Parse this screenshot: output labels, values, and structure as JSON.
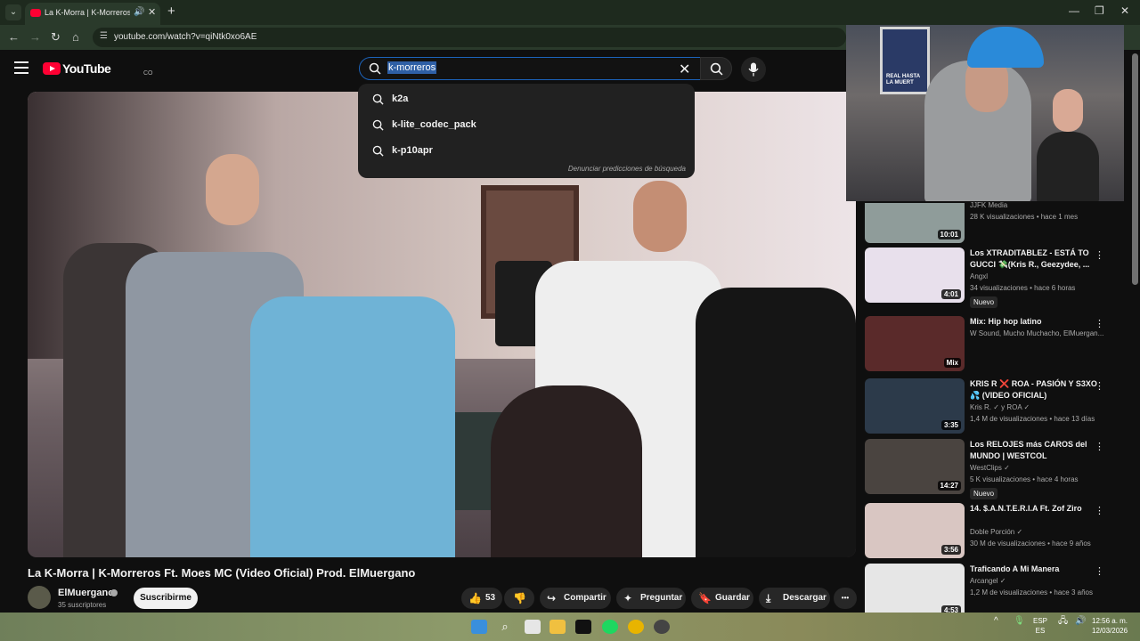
{
  "browser": {
    "tab_title": "La K-Morra | K-Morreros Ft",
    "url": "youtube.com/watch?v=qiNtk0xo6AE",
    "tab_menu_glyph": "⌄",
    "new_tab_glyph": "+",
    "close_glyph": "✕"
  },
  "header": {
    "logo_text": "YouTube",
    "country_code": "CO",
    "search_value": "k-morreros"
  },
  "suggestions": {
    "items": [
      "k2a",
      "k-lite_codec_pack",
      "k-p10apr"
    ],
    "report_label": "Denunciar predicciones de búsqueda"
  },
  "webcam": {
    "poster_text": "REAL HASTA LA MUERT"
  },
  "video": {
    "title": "La K-Morra | K-Morreros Ft. Moes MC (Video Oficial) Prod. ElMuergano",
    "channel": "ElMuergano",
    "subscribers": "35 suscriptores",
    "subscribe_label": "Suscribirme",
    "likes": "53",
    "share_label": "Compartir",
    "ask_label": "Preguntar",
    "save_label": "Guardar",
    "download_label": "Descargar",
    "more_glyph": "•••"
  },
  "sidebar": {
    "items": [
      {
        "title": "",
        "channel": "JJFK Media",
        "meta": "28 K visualizaciones • hace 1 mes",
        "badge": "",
        "duration": "10:01",
        "thumb_color": "#8f9c9a"
      },
      {
        "title": "Los XTRADITABLEZ - ESTÁ TO GUCCI 💸(Kris R., Geezydee, ...",
        "channel": "Angxl",
        "meta": "34 visualizaciones • hace 6 horas",
        "badge": "Nuevo",
        "duration": "4:01",
        "thumb_color": "#e8e0ec"
      },
      {
        "title": "Mix: Hip hop latino",
        "channel": "W Sound, Mucho Muchacho, ElMuergan...",
        "meta": "",
        "badge": "",
        "duration": "Mix",
        "thumb_color": "#5a2a2a"
      },
      {
        "title": "KRIS R ❌ ROA - PASIÓN Y S3XO 💦 (VIDEO OFICIAL)",
        "channel": "Kris R. ✓ y ROA ✓",
        "meta": "1,4 M de visualizaciones • hace 13 días",
        "badge": "",
        "duration": "3:35",
        "thumb_color": "#2c3a4a"
      },
      {
        "title": "Los RELOJES más CAROS del MUNDO | WESTCOL",
        "channel": "WestClips ✓",
        "meta": "5 K visualizaciones • hace 4 horas",
        "badge": "Nuevo",
        "duration": "14:27",
        "thumb_color": "#4a4440"
      },
      {
        "title": "14. $.A.N.T.E.R.I.A Ft.  Zof Ziro",
        "channel": "Doble Porción ✓",
        "meta": "30 M de visualizaciones • hace 9 años",
        "badge": "",
        "duration": "3:56",
        "thumb_color": "#d9c6c2"
      },
      {
        "title": "Traficando A Mi Manera",
        "channel": "Arcangel ✓",
        "meta": "1,2 M de visualizaciones • hace 3 años",
        "badge": "",
        "duration": "4:53",
        "thumb_color": "#e6e6e6"
      }
    ],
    "more_glyph": "⋮"
  },
  "taskbar": {
    "lang_top": "ESP",
    "lang_bottom": "ES",
    "time": "12:56 a. m.",
    "date": "12/03/2026"
  },
  "icons": {
    "back": "back-arrow-icon",
    "forward": "forward-arrow-icon",
    "reload": "reload-icon",
    "home": "home-icon",
    "search": "search-icon",
    "mic": "microphone-icon",
    "like": "thumbs-up-icon",
    "dislike": "thumbs-down-icon"
  },
  "colors": {
    "yt_red": "#ff0033",
    "background": "#0f0f0f",
    "search_focus": "#1c62b9",
    "browser_frame": "#2a3a2b"
  }
}
